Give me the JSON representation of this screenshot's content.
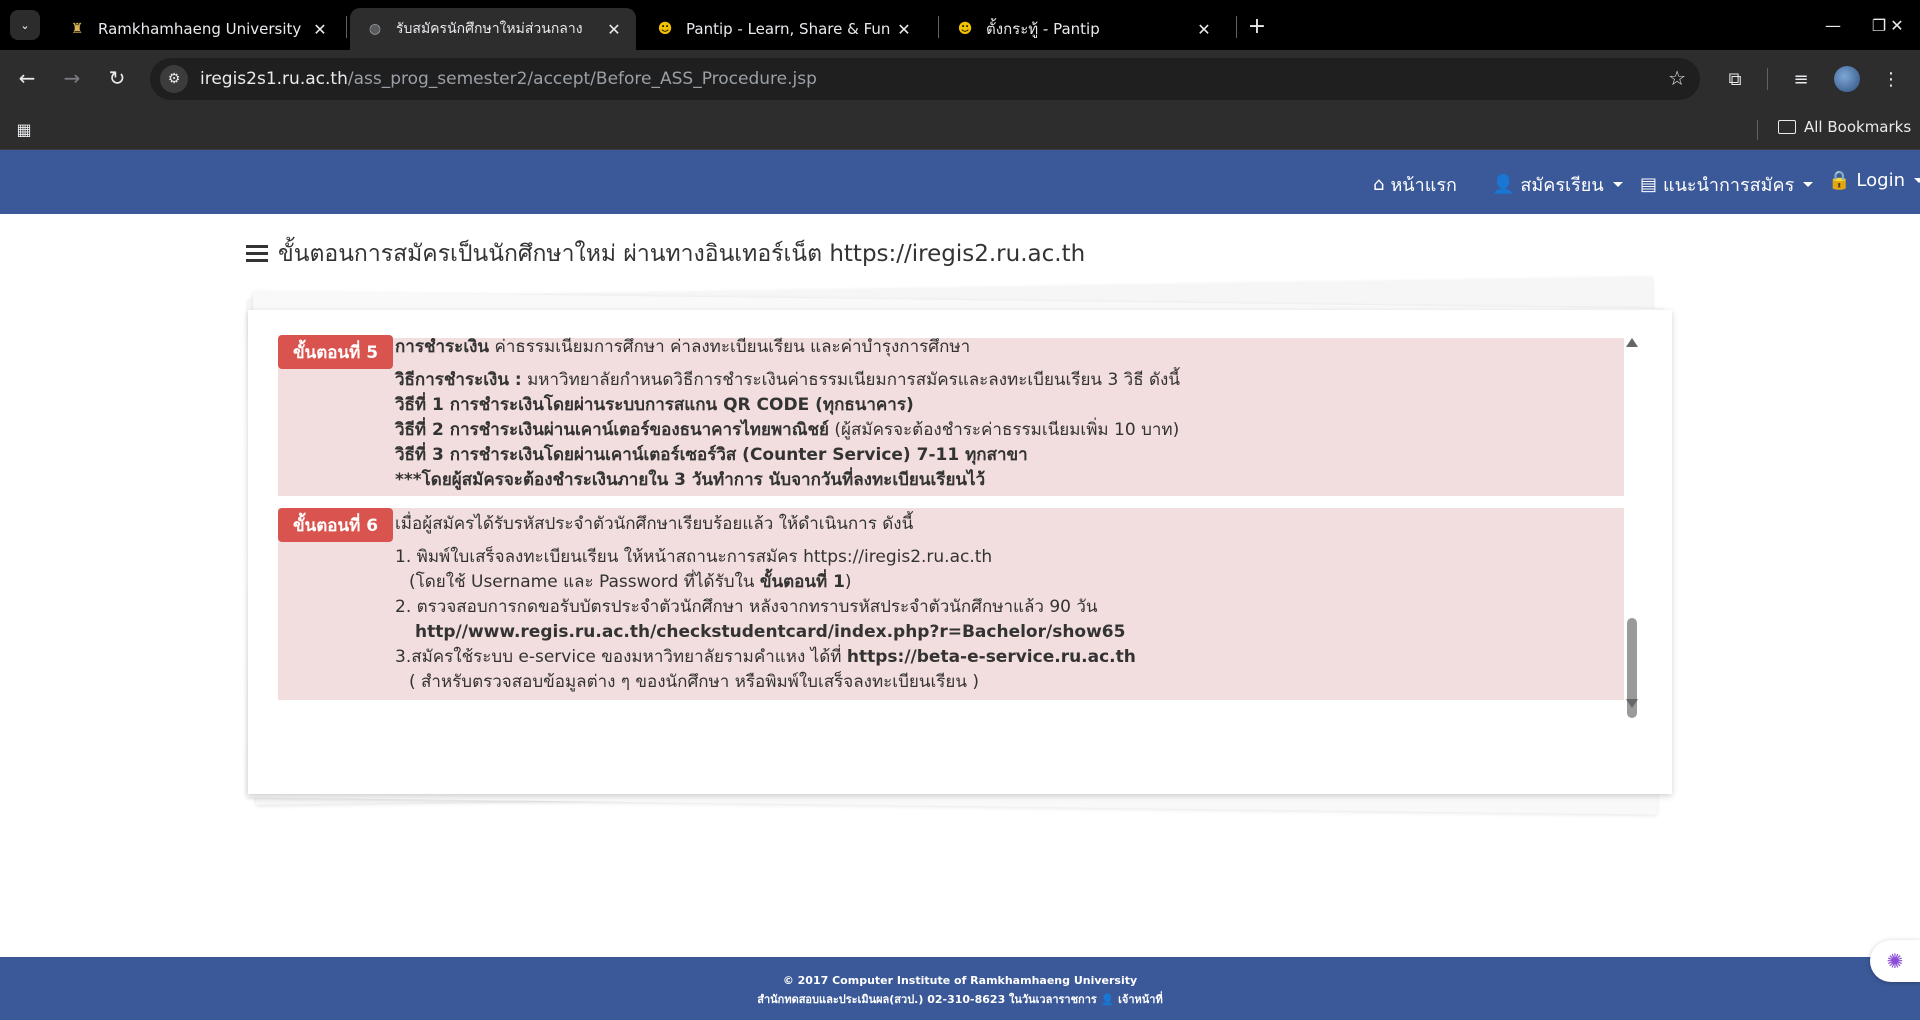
{
  "browser": {
    "tabs": [
      {
        "title": "Ramkhamhaeng University",
        "icon": "university-favicon"
      },
      {
        "title": "รับสมัครนักศึกษาใหม่ส่วนกลาง",
        "icon": "globe-favicon"
      },
      {
        "title": "Pantip - Learn, Share & Fun",
        "icon": "pantip-favicon"
      },
      {
        "title": "ตั้งกระทู้ - Pantip",
        "icon": "pantip-favicon"
      }
    ],
    "url_host": "iregis2s1.ru.ac.th",
    "url_path": "/ass_prog_semester2/accept/Before_ASS_Procedure.jsp",
    "all_bookmarks": "All Bookmarks"
  },
  "nav": {
    "home": "หน้าแรก",
    "register": "สมัครเรียน",
    "guide": "แนะนำการสมัคร",
    "login": "Login"
  },
  "page": {
    "heading": "ขั้นตอนการสมัครเป็นนักศึกษาใหม่ ผ่านทางอินเทอร์เน็ต https://iregis2.ru.ac.th"
  },
  "step5": {
    "badge": "ขั้นตอนที่ 5",
    "title_bold": "การชำระเงิน",
    "title_rest": " ค่าธรรมเนียมการศึกษา ค่าลงทะเบียนเรียน และค่าบำรุงการศึกษา",
    "method_bold": "วิธีการชำระเงิน :",
    "method_rest": " มหาวิทยาลัยกำหนดวิธีการชำระเงินค่าธรรมเนียมการสมัครและลงทะเบียนเรียน 3 วิธี ดังนี้",
    "way1": "วิธีที่ 1 การชำระเงินโดยผ่านระบบการสแกน QR CODE (ทุกธนาคาร)",
    "way2_bold": "วิธีที่ 2 การชำระเงินผ่านเคาน์เตอร์ของธนาคารไทยพาณิชย์",
    "way2_rest": " (ผู้สมัครจะต้องชำระค่าธรรมเนียมเพิ่ม 10 บาท)",
    "way3": "วิธีที่ 3 การชำระเงินโดยผ่านเคาน์เตอร์เซอร์วิส (Counter Service) 7-11 ทุกสาขา",
    "note": "***โดยผู้สมัครจะต้องชำระเงินภายใน 3 วันทำการ นับจากวันที่ลงทะเบียนเรียนไว้"
  },
  "step6": {
    "badge": "ขั้นตอนที่ 6",
    "intro": "เมื่อผู้สมัครได้รับรหัสประจำตัวนักศึกษาเรียบร้อยแล้ว ให้ดำเนินการ ดังนี้",
    "item1": "1. พิมพ์ใบเสร็จลงทะเบียนเรียน ให้หน้าสถานะการสมัคร https://iregis2.ru.ac.th",
    "item1_sub_a": "(โดยใช้ Username และ Password ที่ได้รับใน ",
    "item1_sub_b": "ขั้นตอนที่ 1",
    "item1_sub_c": ")",
    "item2": "2. ตรวจสอบการกดขอรับบัตรประจำตัวนักศึกษา หลังจากทราบรหัสประจำตัวนักศึกษาแล้ว 90 วัน",
    "item2_link": "http//www.regis.ru.ac.th/checkstudentcard/index.php?r=Bachelor/show65",
    "item3_a": "3.สมัครใช้ระบบ e-service ของมหาวิทยาลัยรามคำแหง ได้ที่ ",
    "item3_link": "https://beta-e-service.ru.ac.th",
    "item3_sub": "( สำหรับตรวจสอบข้อมูลต่าง ๆ ของนักศึกษา หรือพิมพ์ใบเสร็จลงทะเบียนเรียน )"
  },
  "footer": {
    "line1": "© 2017 Computer Institute of Ramkhamhaeng University",
    "line2a": "สำนักทดสอบและประเมินผล(สวป.) 02-310-8623 ในวันเวลาราชการ ",
    "line2b": "เจ้าหน้าที่"
  },
  "colors": {
    "nav_bg": "#3b5998",
    "step_bg": "#f2dede",
    "badge_bg": "#d9534f"
  }
}
